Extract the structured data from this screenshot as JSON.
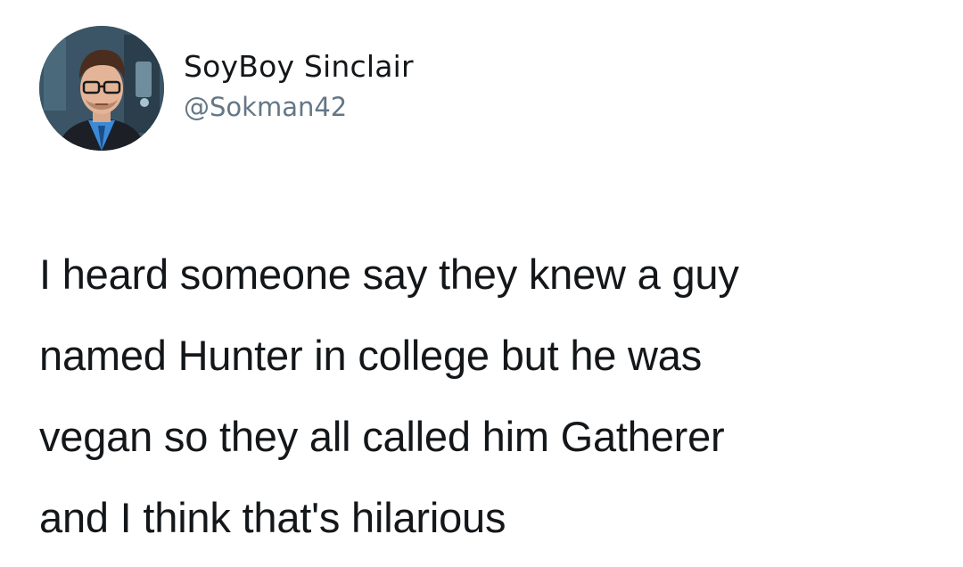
{
  "tweet": {
    "author": {
      "display_name": "SoyBoy Sinclair",
      "handle": "@Sokman42"
    },
    "text": "I heard someone say they knew a guy\nnamed Hunter in college but he was\nvegan so they all called him Gatherer\nand I think that's hilarious"
  },
  "icons": {
    "avatar": "profile-photo"
  },
  "colors": {
    "background": "#ffffff",
    "text": "#14171a",
    "handle": "#657786"
  }
}
